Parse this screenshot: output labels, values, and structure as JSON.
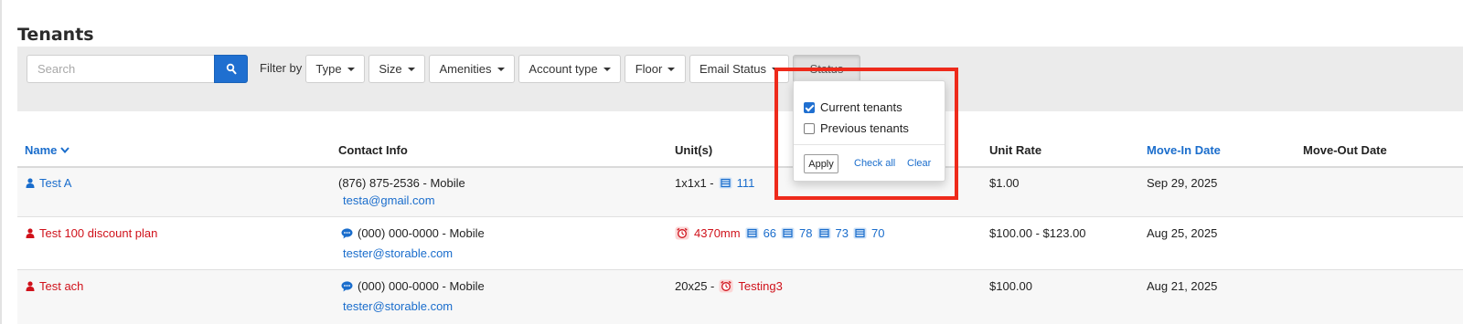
{
  "page": {
    "title": "Tenants"
  },
  "search": {
    "placeholder": "Search",
    "value": ""
  },
  "filters": {
    "label": "Filter by",
    "buttons": [
      "Type",
      "Size",
      "Amenities",
      "Account type",
      "Floor",
      "Email Status",
      "Status"
    ]
  },
  "status_dropdown": {
    "options": [
      {
        "label": "Current tenants",
        "checked": true
      },
      {
        "label": "Previous tenants",
        "checked": false
      }
    ],
    "apply_label": "Apply",
    "check_all_label": "Check all",
    "clear_label": "Clear"
  },
  "table": {
    "headers": {
      "name": "Name",
      "contact": "Contact Info",
      "units": "Unit(s)",
      "rate": "Unit Rate",
      "move_in": "Move-In Date",
      "move_out": "Move-Out Date"
    },
    "rows": [
      {
        "name": "Test A",
        "phone": "(876) 875-2536 - Mobile",
        "email": "testa@gmail.com",
        "unit_prefix": "1x1x1 -",
        "unit_alert": "",
        "units": [
          "111"
        ],
        "rate": "$1.00",
        "move_in": "Sep 29, 2025",
        "move_out": ""
      },
      {
        "name": "Test 100 discount plan",
        "phone": "(000) 000-0000 - Mobile",
        "email": "tester@storable.com",
        "unit_prefix": "",
        "unit_alert": "4370mm",
        "units": [
          "66",
          "78",
          "73",
          "70"
        ],
        "rate": "$100.00 - $123.00",
        "move_in": "Aug 25, 2025",
        "move_out": ""
      },
      {
        "name": "Test ach",
        "phone": "(000) 000-0000 - Mobile",
        "email": "tester@storable.com",
        "unit_prefix": "20x25 -",
        "unit_alert": "Testing3",
        "units": [],
        "rate": "$100.00",
        "move_in": "Aug 21, 2025",
        "move_out": ""
      }
    ]
  },
  "colors": {
    "link": "#1a6dcc",
    "alert_red": "#d0121b",
    "search_button": "#1f6fd0",
    "highlight": "#ee2a1b",
    "filter_bar_bg": "#ebebeb"
  },
  "icons": {
    "search": "search-icon",
    "sort": "chevron-down-icon",
    "user": "user-icon",
    "chat": "chat-bubble-icon",
    "unit": "storage-unit-icon",
    "alarm": "alarm-clock-icon"
  }
}
